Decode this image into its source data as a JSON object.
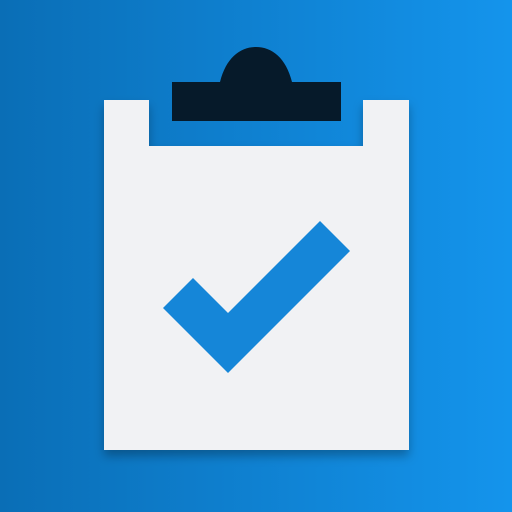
{
  "icon": {
    "name": "clipboard-check-icon",
    "colors": {
      "background_start": "#0A6EB6",
      "background_end": "#1494EC",
      "paper": "#F1F2F4",
      "clip": "#061A2A",
      "check": "#1586D8"
    }
  }
}
